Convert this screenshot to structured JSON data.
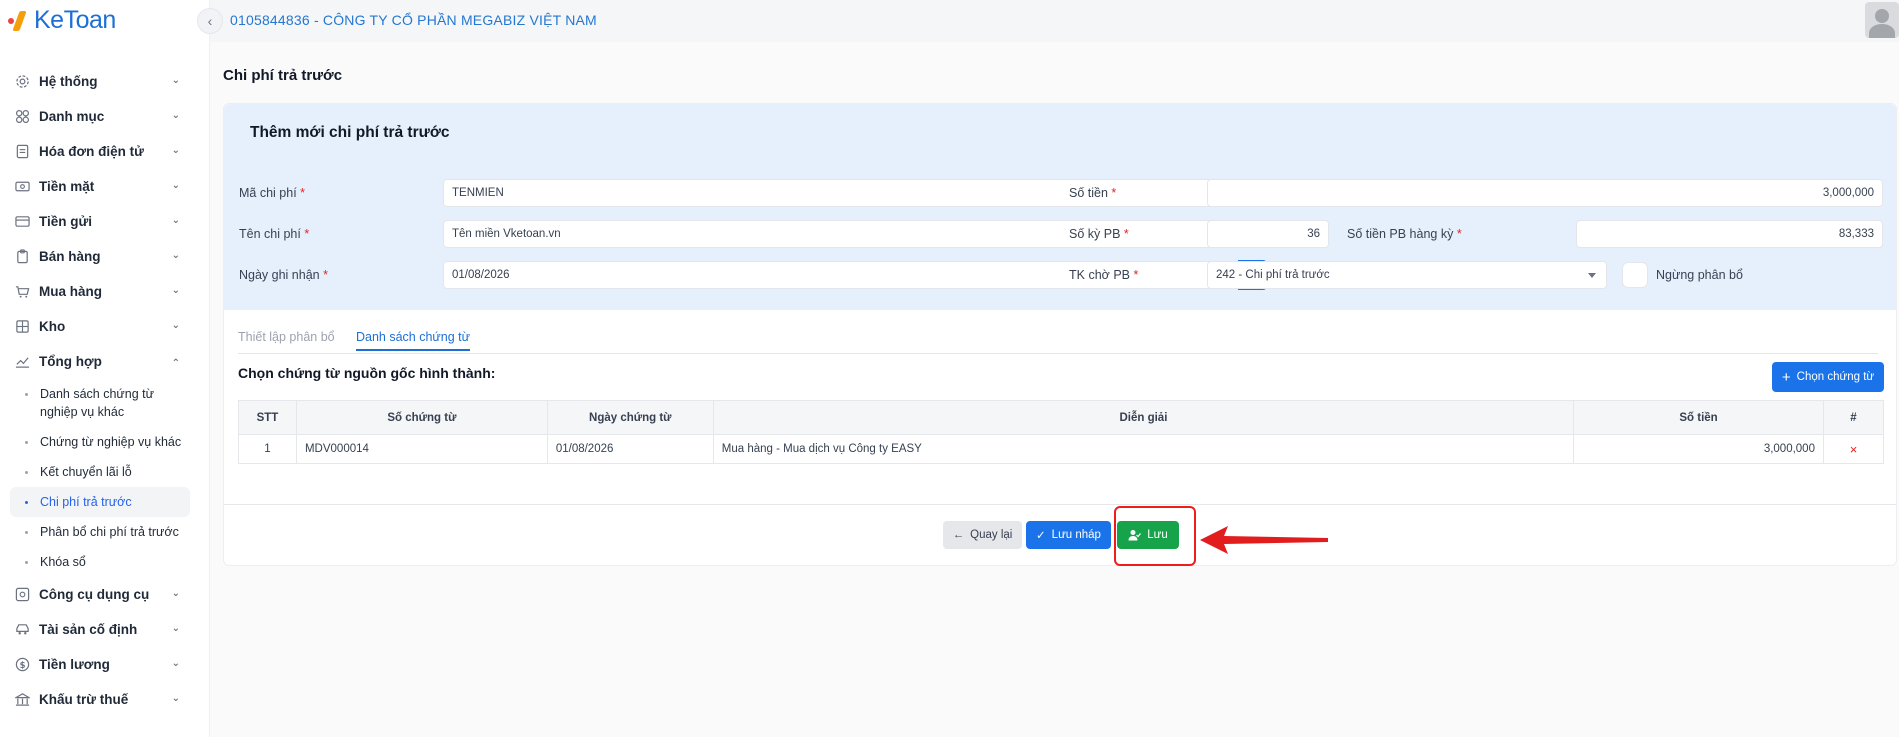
{
  "app": {
    "logo_text": "KeToan"
  },
  "header": {
    "company": "0105844836 - CÔNG TY CỔ PHẦN MEGABIZ VIỆT NAM"
  },
  "sidebar": {
    "items": [
      {
        "label": "Hệ thống",
        "icon": "gear-icon"
      },
      {
        "label": "Danh mục",
        "icon": "grid-icon"
      },
      {
        "label": "Hóa đơn điện tử",
        "icon": "invoice-icon"
      },
      {
        "label": "Tiền mặt",
        "icon": "cash-icon"
      },
      {
        "label": "Tiền gửi",
        "icon": "bank-card-icon"
      },
      {
        "label": "Bán hàng",
        "icon": "clipboard-icon"
      },
      {
        "label": "Mua hàng",
        "icon": "cart-icon"
      },
      {
        "label": "Kho",
        "icon": "warehouse-icon"
      },
      {
        "label": "Tổng hợp",
        "icon": "chart-icon"
      }
    ],
    "sub_items": [
      {
        "label": "Danh sách chứng từ nghiệp vụ khác"
      },
      {
        "label": "Chứng từ nghiệp vụ khác"
      },
      {
        "label": "Kết chuyển lãi lỗ"
      },
      {
        "label": "Chi phí trả trước"
      },
      {
        "label": "Phân bổ chi phí trả trước"
      },
      {
        "label": "Khóa sổ"
      }
    ],
    "items_after": [
      {
        "label": "Công cụ dụng cụ",
        "icon": "tools-icon"
      },
      {
        "label": "Tài sản cố định",
        "icon": "car-icon"
      },
      {
        "label": "Tiền lương",
        "icon": "dollar-icon"
      },
      {
        "label": "Khấu trừ thuế",
        "icon": "bank-icon"
      }
    ]
  },
  "page": {
    "title": "Chi phí trả trước"
  },
  "form": {
    "title": "Thêm mới chi phí trả trước",
    "ma_chi_phi": {
      "label": "Mã chi phí",
      "value": "TENMIEN"
    },
    "ten_chi_phi": {
      "label": "Tên chi phí",
      "value": "Tên miền Vketoan.vn"
    },
    "ngay_ghi_nhan": {
      "label": "Ngày ghi nhận",
      "value": "01/08/2026"
    },
    "so_tien": {
      "label": "Số tiền",
      "value": "3,000,000"
    },
    "so_ky_pb": {
      "label": "Số kỳ PB",
      "value": "36"
    },
    "so_tien_pb": {
      "label": "Số tiền PB hàng kỳ",
      "value": "83,333"
    },
    "tk_cho_pb": {
      "label": "TK chờ PB",
      "value": "242 - Chi phí trả trước"
    },
    "ngung_phan_bo": {
      "label": "Ngừng phân bổ",
      "checked": false
    },
    "required_mark": "*"
  },
  "tabs": [
    {
      "label": "Thiết lập phân bổ"
    },
    {
      "label": "Danh sách chứng từ"
    }
  ],
  "section": {
    "title": "Chọn chứng từ nguồn gốc hình thành:",
    "choose_button": "Chọn chứng từ"
  },
  "table": {
    "headers": [
      "STT",
      "Số chứng từ",
      "Ngày chứng từ",
      "Diễn giải",
      "Số tiền",
      "#"
    ],
    "rows": [
      {
        "stt": "1",
        "so_chung_tu": "MDV000014",
        "ngay": "01/08/2026",
        "dien_giai": "Mua hàng - Mua dịch vụ Công ty EASY",
        "so_tien": "3,000,000",
        "delete": "×"
      }
    ]
  },
  "actions": {
    "back": "Quay lại",
    "draft": "Lưu nháp",
    "save": "Lưu"
  },
  "colors": {
    "primary": "#1a73e8",
    "success": "#16a34a",
    "danger": "#dc2626",
    "highlight": "#ef1c1c"
  }
}
